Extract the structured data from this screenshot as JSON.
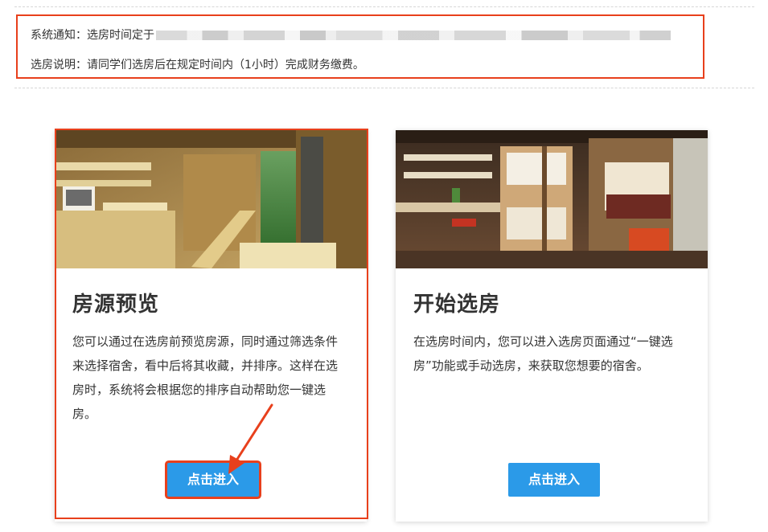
{
  "notice": {
    "system_notice": "系统通知：选房时间定于",
    "instructions": "选房说明：请同学们选房后在规定时间内（1小时）完成财务缴费。"
  },
  "cards": [
    {
      "title": "房源预览",
      "description": "您可以通过在选房前预览房源，同时通过筛选条件来选择宿舍，看中后将其收藏，并排序。这样在选房时，系统将会根据您的排序自动帮助您一键选房。",
      "button_label": "点击进入"
    },
    {
      "title": "开始选房",
      "description": "在选房时间内，您可以进入选房页面通过“一键选房”功能或手动选房，来获取您想要的宿舍。",
      "button_label": "点击进入"
    }
  ],
  "colors": {
    "highlight": "#e8401c",
    "button": "#2b9ae8"
  }
}
